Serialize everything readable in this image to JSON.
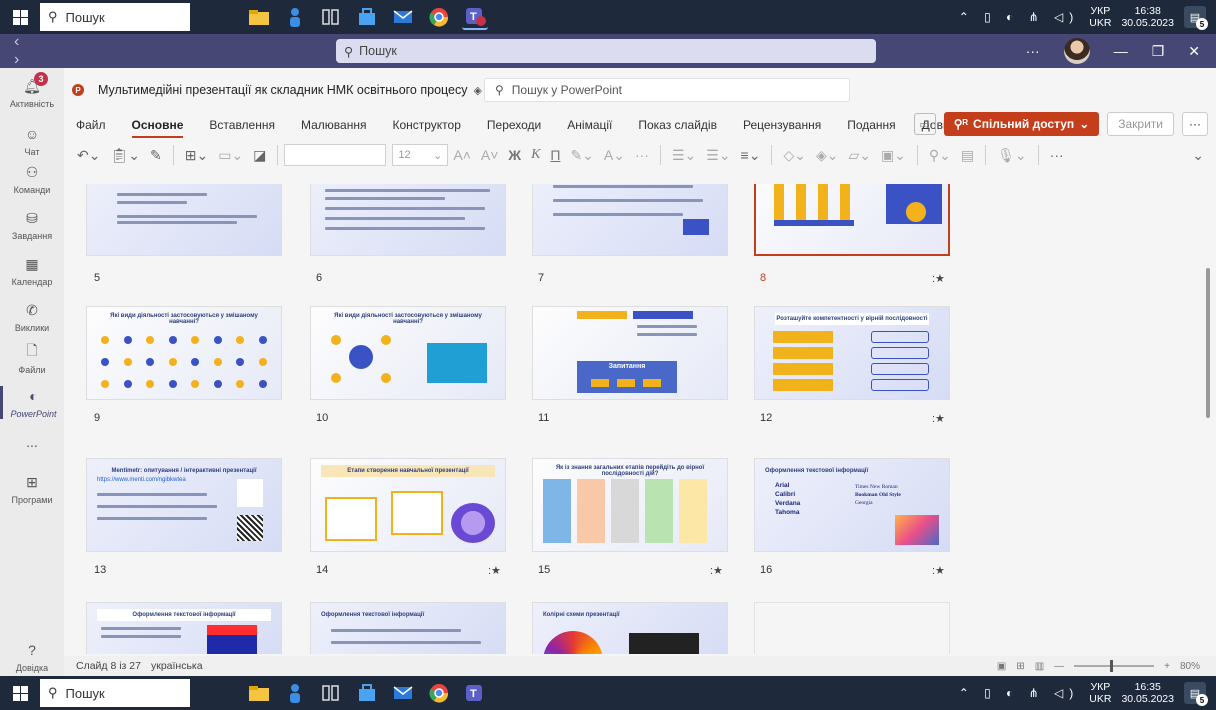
{
  "taskbar_top": {
    "search_placeholder": "Пошук",
    "lang_line1": "УКР",
    "lang_line2": "UKR",
    "time": "16:38",
    "date": "30.05.2023",
    "notification_count": "5",
    "teams_badge": "3"
  },
  "taskbar_bottom": {
    "search_placeholder": "Пошук",
    "lang_line1": "УКР",
    "lang_line2": "UKR",
    "time": "16:35",
    "date": "30.05.2023",
    "notification_count": "5"
  },
  "teams": {
    "search_placeholder": "Пошук",
    "rail": [
      {
        "label": "Активність",
        "icon": "bell-icon",
        "badge": "3"
      },
      {
        "label": "Чат",
        "icon": "chat-icon"
      },
      {
        "label": "Команди",
        "icon": "teams-icon"
      },
      {
        "label": "Завдання",
        "icon": "assignments-icon"
      },
      {
        "label": "Календар",
        "icon": "calendar-icon"
      },
      {
        "label": "Виклики",
        "icon": "phone-icon"
      },
      {
        "label": "Файли",
        "icon": "file-icon"
      },
      {
        "label": "PowerPoint",
        "icon": "powerpoint-icon"
      },
      {
        "label": "...",
        "icon": "more-icon"
      },
      {
        "label": "Програми",
        "icon": "apps-icon"
      },
      {
        "label": "Довідка",
        "icon": "help-icon"
      }
    ]
  },
  "ppt": {
    "doc_title": "Мультимедійні презентації як складник НМК освітнього процесу",
    "search_placeholder": "Пошук у PowerPoint",
    "tabs": [
      "Файл",
      "Основне",
      "Вставлення",
      "Малювання",
      "Конструктор",
      "Переходи",
      "Анімації",
      "Показ слайдів",
      "Рецензування",
      "Подання",
      "Довідка"
    ],
    "active_tab": "Основне",
    "share_label": "Спільний доступ",
    "close_label": "Закрити",
    "font_size": "12",
    "bold_glyph": "Ж",
    "italic_glyph": "К",
    "underline_glyph": "П",
    "status_slide": "Слайд 8 із 27",
    "status_lang": "українська",
    "zoom": "80%",
    "accent": "#c43e1c"
  },
  "slides": [
    {
      "num": "5",
      "title": "",
      "star": false
    },
    {
      "num": "6",
      "title": "",
      "star": false
    },
    {
      "num": "7",
      "title": "",
      "star": false
    },
    {
      "num": "8",
      "title": "",
      "star": true,
      "selected": true
    },
    {
      "num": "9",
      "title": "Які види діяльності застосовуються у змішаному навчанні?",
      "star": false
    },
    {
      "num": "10",
      "title": "Які види діяльності застосовуються у змішаному навчанні?",
      "star": false
    },
    {
      "num": "11",
      "title": "",
      "star": false
    },
    {
      "num": "12",
      "title": "Розташуйте компетентності у вірній послідовності",
      "star": true
    },
    {
      "num": "13",
      "title": "Mentimetr: опитування / інтерактивні презентації",
      "star": false
    },
    {
      "num": "14",
      "title": "Етапи створення навчальної презентації",
      "star": true
    },
    {
      "num": "15",
      "title": "Як із знання загальних етапів перейдіть до вірної послідовності дій?",
      "star": true
    },
    {
      "num": "16",
      "title": "Оформлення текстової інформації",
      "star": true
    },
    {
      "num": "",
      "title": "Оформлення текстової інформації",
      "star": false
    },
    {
      "num": "",
      "title": "Оформлення текстової інформації",
      "star": false
    },
    {
      "num": "",
      "title": "Колірні схеми презентації",
      "star": false
    }
  ],
  "slide_texts": {
    "s11_box": "Запитання",
    "s16_fonts_left": [
      "Arial",
      "Calibri",
      "Verdana",
      "Tahoma"
    ],
    "s16_fonts_right": [
      "Times New Roman",
      "Bookman Old Style",
      "Georgia"
    ],
    "s13_url": "https://www.menti.com/ngibkwtea"
  }
}
